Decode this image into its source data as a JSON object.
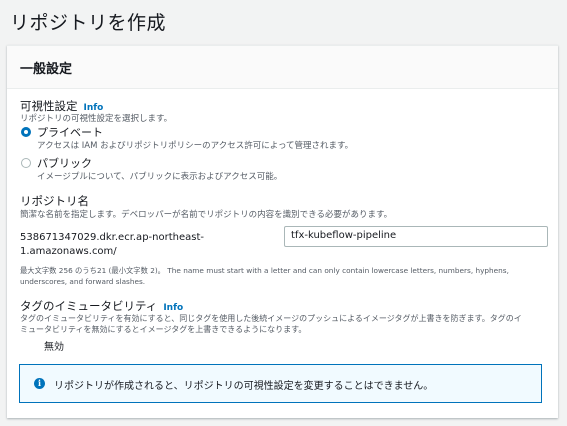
{
  "page": {
    "title": "リポジトリを作成"
  },
  "general": {
    "header": "一般設定",
    "visibility": {
      "label": "可視性設定",
      "info": "Info",
      "description": "リポジトリの可視性設定を選択します。",
      "options": [
        {
          "label": "プライベート",
          "description": "アクセスは IAM およびリポジトリポリシーのアクセス許可によって管理されます。",
          "selected": true
        },
        {
          "label": "パブリック",
          "description": "イメージプルについて、パブリックに表示およびアクセス可能。",
          "selected": false
        }
      ]
    },
    "repo_name": {
      "label": "リポジトリ名",
      "description": "簡潔な名前を指定します。デベロッパーが名前でリポジトリの内容を識別できる必要があります。",
      "prefix_line1": "538671347029.dkr.ecr.ap-northeast-",
      "prefix_line2": "1.amazonaws.com/",
      "value": "tfx-kubeflow-pipeline",
      "hint_line1": "最大文字数 256 のうち21 (最小文字数 2)。 The name must start with a letter and can only contain lowercase letters, numbers, hyphens,",
      "hint_line2": "underscores, and forward slashes."
    },
    "immutability": {
      "label": "タグのイミュータビリティ",
      "info": "Info",
      "description_line1": "タグのイミュータビリティを有効にすると、同じタグを使用した後続イメージのプッシュによるイメージタグが上書きを防ぎます。タグのイ",
      "description_line2": "ミュータビリティを無効にするとイメージタグを上書きできるようになります。",
      "toggle_label": "無効",
      "enabled": false
    },
    "alert": {
      "icon": "info-icon",
      "text": "リポジトリが作成されると、リポジトリの可視性設定を変更することはできません。"
    }
  }
}
